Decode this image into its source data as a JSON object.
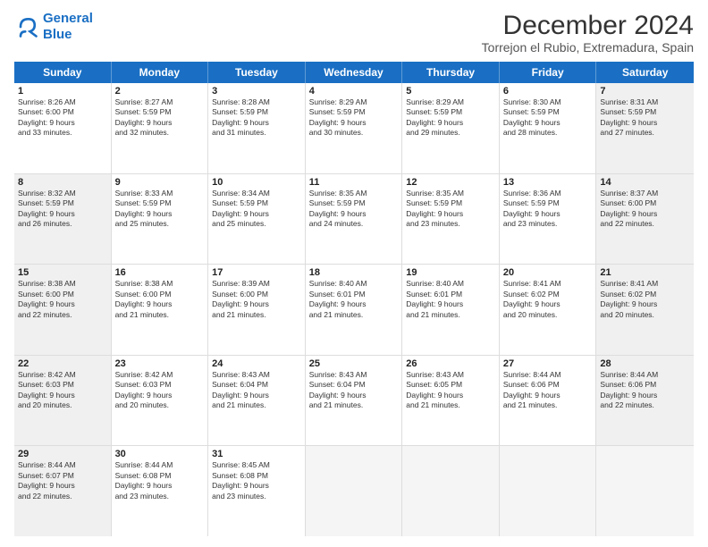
{
  "logo": {
    "line1": "General",
    "line2": "Blue"
  },
  "title": "December 2024",
  "location": "Torrejon el Rubio, Extremadura, Spain",
  "header_days": [
    "Sunday",
    "Monday",
    "Tuesday",
    "Wednesday",
    "Thursday",
    "Friday",
    "Saturday"
  ],
  "weeks": [
    [
      {
        "day": "1",
        "rise": "Sunrise: 8:26 AM",
        "set": "Sunset: 6:00 PM",
        "daylight": "Daylight: 9 hours",
        "mins": "and 33 minutes.",
        "shaded": false
      },
      {
        "day": "2",
        "rise": "Sunrise: 8:27 AM",
        "set": "Sunset: 5:59 PM",
        "daylight": "Daylight: 9 hours",
        "mins": "and 32 minutes.",
        "shaded": false
      },
      {
        "day": "3",
        "rise": "Sunrise: 8:28 AM",
        "set": "Sunset: 5:59 PM",
        "daylight": "Daylight: 9 hours",
        "mins": "and 31 minutes.",
        "shaded": false
      },
      {
        "day": "4",
        "rise": "Sunrise: 8:29 AM",
        "set": "Sunset: 5:59 PM",
        "daylight": "Daylight: 9 hours",
        "mins": "and 30 minutes.",
        "shaded": false
      },
      {
        "day": "5",
        "rise": "Sunrise: 8:29 AM",
        "set": "Sunset: 5:59 PM",
        "daylight": "Daylight: 9 hours",
        "mins": "and 29 minutes.",
        "shaded": false
      },
      {
        "day": "6",
        "rise": "Sunrise: 8:30 AM",
        "set": "Sunset: 5:59 PM",
        "daylight": "Daylight: 9 hours",
        "mins": "and 28 minutes.",
        "shaded": false
      },
      {
        "day": "7",
        "rise": "Sunrise: 8:31 AM",
        "set": "Sunset: 5:59 PM",
        "daylight": "Daylight: 9 hours",
        "mins": "and 27 minutes.",
        "shaded": true
      }
    ],
    [
      {
        "day": "8",
        "rise": "Sunrise: 8:32 AM",
        "set": "Sunset: 5:59 PM",
        "daylight": "Daylight: 9 hours",
        "mins": "and 26 minutes.",
        "shaded": true
      },
      {
        "day": "9",
        "rise": "Sunrise: 8:33 AM",
        "set": "Sunset: 5:59 PM",
        "daylight": "Daylight: 9 hours",
        "mins": "and 25 minutes.",
        "shaded": false
      },
      {
        "day": "10",
        "rise": "Sunrise: 8:34 AM",
        "set": "Sunset: 5:59 PM",
        "daylight": "Daylight: 9 hours",
        "mins": "and 25 minutes.",
        "shaded": false
      },
      {
        "day": "11",
        "rise": "Sunrise: 8:35 AM",
        "set": "Sunset: 5:59 PM",
        "daylight": "Daylight: 9 hours",
        "mins": "and 24 minutes.",
        "shaded": false
      },
      {
        "day": "12",
        "rise": "Sunrise: 8:35 AM",
        "set": "Sunset: 5:59 PM",
        "daylight": "Daylight: 9 hours",
        "mins": "and 23 minutes.",
        "shaded": false
      },
      {
        "day": "13",
        "rise": "Sunrise: 8:36 AM",
        "set": "Sunset: 5:59 PM",
        "daylight": "Daylight: 9 hours",
        "mins": "and 23 minutes.",
        "shaded": false
      },
      {
        "day": "14",
        "rise": "Sunrise: 8:37 AM",
        "set": "Sunset: 6:00 PM",
        "daylight": "Daylight: 9 hours",
        "mins": "and 22 minutes.",
        "shaded": true
      }
    ],
    [
      {
        "day": "15",
        "rise": "Sunrise: 8:38 AM",
        "set": "Sunset: 6:00 PM",
        "daylight": "Daylight: 9 hours",
        "mins": "and 22 minutes.",
        "shaded": true
      },
      {
        "day": "16",
        "rise": "Sunrise: 8:38 AM",
        "set": "Sunset: 6:00 PM",
        "daylight": "Daylight: 9 hours",
        "mins": "and 21 minutes.",
        "shaded": false
      },
      {
        "day": "17",
        "rise": "Sunrise: 8:39 AM",
        "set": "Sunset: 6:00 PM",
        "daylight": "Daylight: 9 hours",
        "mins": "and 21 minutes.",
        "shaded": false
      },
      {
        "day": "18",
        "rise": "Sunrise: 8:40 AM",
        "set": "Sunset: 6:01 PM",
        "daylight": "Daylight: 9 hours",
        "mins": "and 21 minutes.",
        "shaded": false
      },
      {
        "day": "19",
        "rise": "Sunrise: 8:40 AM",
        "set": "Sunset: 6:01 PM",
        "daylight": "Daylight: 9 hours",
        "mins": "and 21 minutes.",
        "shaded": false
      },
      {
        "day": "20",
        "rise": "Sunrise: 8:41 AM",
        "set": "Sunset: 6:02 PM",
        "daylight": "Daylight: 9 hours",
        "mins": "and 20 minutes.",
        "shaded": false
      },
      {
        "day": "21",
        "rise": "Sunrise: 8:41 AM",
        "set": "Sunset: 6:02 PM",
        "daylight": "Daylight: 9 hours",
        "mins": "and 20 minutes.",
        "shaded": true
      }
    ],
    [
      {
        "day": "22",
        "rise": "Sunrise: 8:42 AM",
        "set": "Sunset: 6:03 PM",
        "daylight": "Daylight: 9 hours",
        "mins": "and 20 minutes.",
        "shaded": true
      },
      {
        "day": "23",
        "rise": "Sunrise: 8:42 AM",
        "set": "Sunset: 6:03 PM",
        "daylight": "Daylight: 9 hours",
        "mins": "and 20 minutes.",
        "shaded": false
      },
      {
        "day": "24",
        "rise": "Sunrise: 8:43 AM",
        "set": "Sunset: 6:04 PM",
        "daylight": "Daylight: 9 hours",
        "mins": "and 21 minutes.",
        "shaded": false
      },
      {
        "day": "25",
        "rise": "Sunrise: 8:43 AM",
        "set": "Sunset: 6:04 PM",
        "daylight": "Daylight: 9 hours",
        "mins": "and 21 minutes.",
        "shaded": false
      },
      {
        "day": "26",
        "rise": "Sunrise: 8:43 AM",
        "set": "Sunset: 6:05 PM",
        "daylight": "Daylight: 9 hours",
        "mins": "and 21 minutes.",
        "shaded": false
      },
      {
        "day": "27",
        "rise": "Sunrise: 8:44 AM",
        "set": "Sunset: 6:06 PM",
        "daylight": "Daylight: 9 hours",
        "mins": "and 21 minutes.",
        "shaded": false
      },
      {
        "day": "28",
        "rise": "Sunrise: 8:44 AM",
        "set": "Sunset: 6:06 PM",
        "daylight": "Daylight: 9 hours",
        "mins": "and 22 minutes.",
        "shaded": true
      }
    ],
    [
      {
        "day": "29",
        "rise": "Sunrise: 8:44 AM",
        "set": "Sunset: 6:07 PM",
        "daylight": "Daylight: 9 hours",
        "mins": "and 22 minutes.",
        "shaded": true
      },
      {
        "day": "30",
        "rise": "Sunrise: 8:44 AM",
        "set": "Sunset: 6:08 PM",
        "daylight": "Daylight: 9 hours",
        "mins": "and 23 minutes.",
        "shaded": false
      },
      {
        "day": "31",
        "rise": "Sunrise: 8:45 AM",
        "set": "Sunset: 6:08 PM",
        "daylight": "Daylight: 9 hours",
        "mins": "and 23 minutes.",
        "shaded": false
      },
      null,
      null,
      null,
      null
    ]
  ]
}
